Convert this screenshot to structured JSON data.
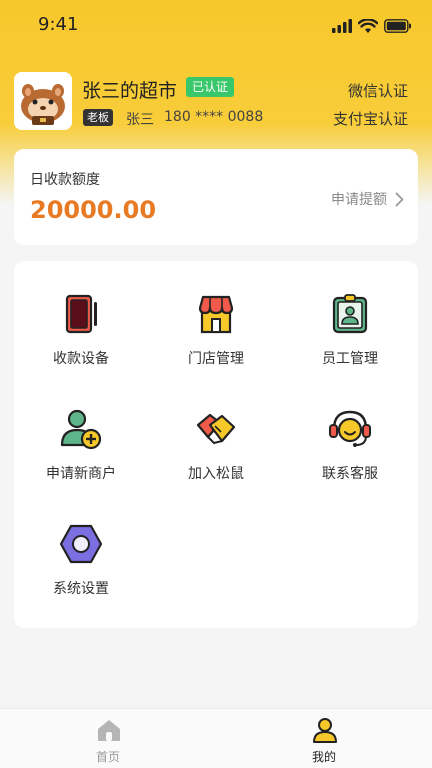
{
  "status_bar": {
    "time": "9:41"
  },
  "profile": {
    "store_name": "张三的超市",
    "verified_badge": "已认证",
    "role_badge": "老板",
    "owner_name": "张三",
    "phone": "180 **** 0088",
    "wechat_auth": "微信认证",
    "alipay_auth": "支付宝认证"
  },
  "quota": {
    "label": "日收款额度",
    "value": "20000.00",
    "action": "申请提额"
  },
  "menu": {
    "items": [
      {
        "label": "收款设备",
        "icon": "pos-device-icon"
      },
      {
        "label": "门店管理",
        "icon": "store-icon"
      },
      {
        "label": "员工管理",
        "icon": "employee-badge-icon"
      },
      {
        "label": "申请新商户",
        "icon": "add-user-icon"
      },
      {
        "label": "加入松鼠",
        "icon": "handshake-icon"
      },
      {
        "label": "联系客服",
        "icon": "headset-icon"
      },
      {
        "label": "系统设置",
        "icon": "settings-hexagon-icon"
      }
    ]
  },
  "tabbar": {
    "tabs": [
      {
        "label": "首页",
        "icon": "home-icon",
        "active": false
      },
      {
        "label": "我的",
        "icon": "user-icon",
        "active": true
      }
    ]
  },
  "colors": {
    "brand_yellow": "#f7c82a",
    "quota_orange": "#e87a24",
    "verified_green": "#38c76a",
    "tab_active": "#222222",
    "tab_inactive": "#999999"
  }
}
